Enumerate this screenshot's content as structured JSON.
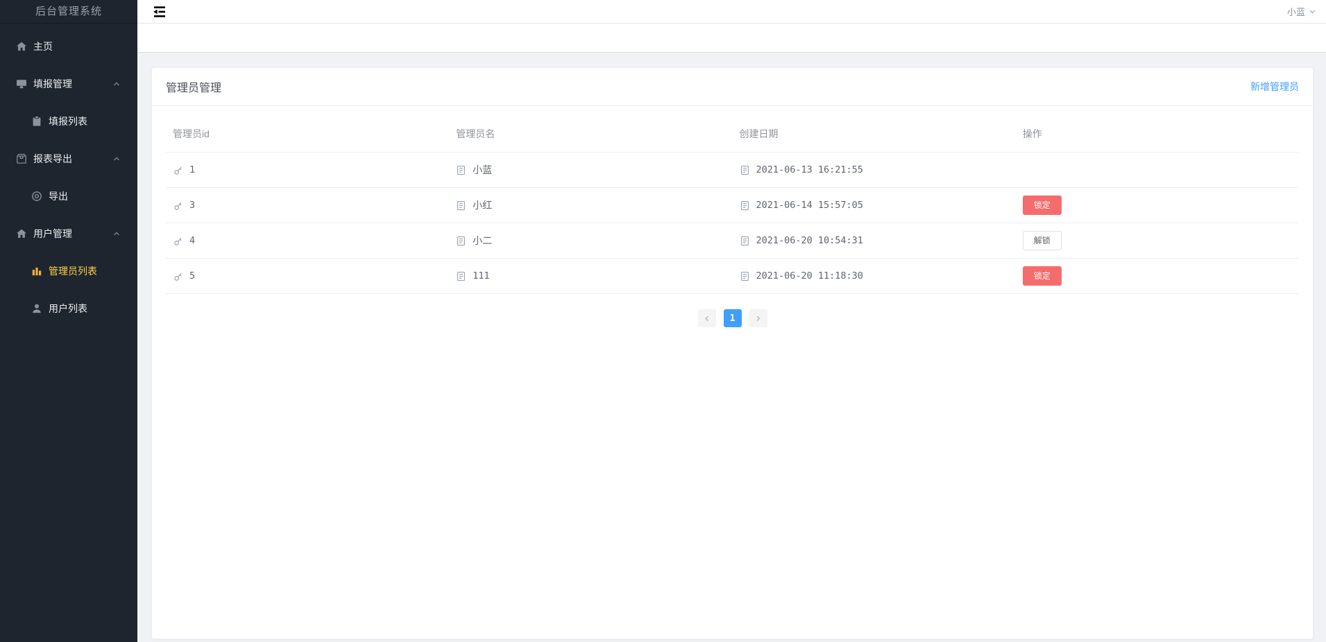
{
  "app": {
    "title": "后台管理系统"
  },
  "header": {
    "user_name": "小蓝"
  },
  "sidebar": {
    "items": [
      {
        "label": "主页",
        "icon": "home-icon"
      },
      {
        "label": "填报管理",
        "icon": "monitor-icon",
        "expandable": true
      },
      {
        "label": "填报列表",
        "icon": "clipboard-icon",
        "submenu": true
      },
      {
        "label": "报表导出",
        "icon": "package-icon",
        "expandable": true
      },
      {
        "label": "导出",
        "icon": "target-icon",
        "submenu": true
      },
      {
        "label": "用户管理",
        "icon": "home-icon",
        "expandable": true
      },
      {
        "label": "管理员列表",
        "icon": "bar-chart-icon",
        "submenu": true,
        "active": true
      },
      {
        "label": "用户列表",
        "icon": "user-icon",
        "submenu": true
      }
    ]
  },
  "main": {
    "card_title": "管理员管理",
    "add_admin_label": "新增管理员",
    "table": {
      "columns": [
        "管理员id",
        "管理员名",
        "创建日期",
        "操作"
      ],
      "rows": [
        {
          "id": "1",
          "name": "小蓝",
          "created": "2021-06-13 16:21:55",
          "action": null
        },
        {
          "id": "3",
          "name": "小红",
          "created": "2021-06-14 15:57:05",
          "action": {
            "label": "锁定",
            "type": "danger"
          }
        },
        {
          "id": "4",
          "name": "小二",
          "created": "2021-06-20 10:54:31",
          "action": {
            "label": "解锁",
            "type": "plain"
          }
        },
        {
          "id": "5",
          "name": "111",
          "created": "2021-06-20 11:18:30",
          "action": {
            "label": "锁定",
            "type": "danger"
          }
        }
      ]
    },
    "pagination": {
      "current": "1"
    }
  },
  "colors": {
    "accent_blue": "#409eff",
    "danger_red": "#f56c6c",
    "active_yellow": "#ffd04b",
    "sidebar_bg": "#1f252e",
    "content_bg": "#f0f2f5"
  }
}
